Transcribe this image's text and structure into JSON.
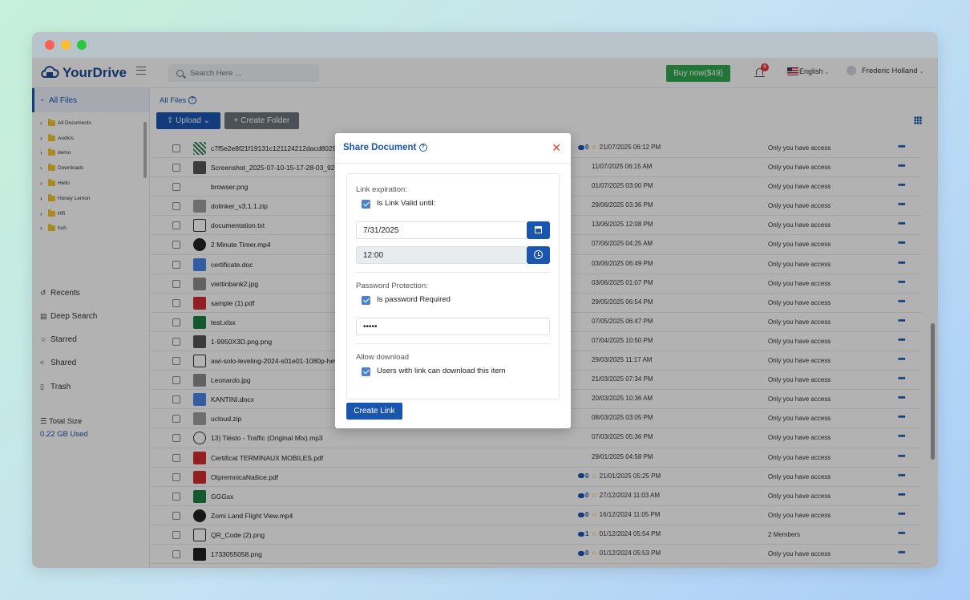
{
  "brand": {
    "name": "YourDrive"
  },
  "header": {
    "search_placeholder": "Search Here ...",
    "buy_label": "Buy now($49)",
    "notification_count": "0",
    "language": "English",
    "user_name": "Frederic Holland"
  },
  "sidebar": {
    "all_files": "All Files",
    "folders": [
      "All Documents",
      "Audios",
      "demo",
      "Downloads",
      "Hello",
      "Honey Lemon",
      "HR",
      "huh"
    ],
    "nav": [
      "Recents",
      "Deep Search",
      "Starred",
      "Shared",
      "Trash"
    ],
    "total_label": "Total Size",
    "used": "0.22 GB Used"
  },
  "main": {
    "breadcrumb": "All Files",
    "upload_label": "Upload",
    "create_folder_label": "Create Folder",
    "files": [
      {
        "name": "c7f5e2e8f21f19131c121124212dacd802923226.png",
        "comments": "0",
        "date": "21/07/2025 06:12 PM",
        "access": "Only you have access",
        "type": "qr"
      },
      {
        "name": "Screenshot_2025-07-10-15-17-28-03_92b64b2...",
        "comments": "",
        "date": "11/07/2025 06:15 AM",
        "access": "Only you have access",
        "type": "photo"
      },
      {
        "name": "browser.png",
        "comments": "",
        "date": "01/07/2025 03:00 PM",
        "access": "Only you have access",
        "type": "blank"
      },
      {
        "name": "dolinker_v3.1.1.zip",
        "comments": "",
        "date": "29/06/2025 03:36 PM",
        "access": "Only you have access",
        "type": "zip"
      },
      {
        "name": "documentation.txt",
        "comments": "",
        "date": "13/06/2025 12:08 PM",
        "access": "Only you have access",
        "type": "txt"
      },
      {
        "name": "2 Minute Timer.mp4",
        "comments": "",
        "date": "07/06/2025 04:25 AM",
        "access": "Only you have access",
        "type": "video"
      },
      {
        "name": "certificate.doc",
        "comments": "",
        "date": "03/06/2025 06:49 PM",
        "access": "Only you have access",
        "type": "doc"
      },
      {
        "name": "viettinbank2.jpg",
        "comments": "",
        "date": "03/06/2025 01:07 PM",
        "access": "Only you have access",
        "type": "photo2"
      },
      {
        "name": "sample (1).pdf",
        "comments": "",
        "date": "29/05/2025 06:54 PM",
        "access": "Only you have access",
        "type": "pdf"
      },
      {
        "name": "test.xlsx",
        "comments": "",
        "date": "07/05/2025 06:47 PM",
        "access": "Only you have access",
        "type": "xls"
      },
      {
        "name": "1-9950X3D.png.png",
        "comments": "",
        "date": "07/04/2025 10:50 PM",
        "access": "Only you have access",
        "type": "photo"
      },
      {
        "name": "awi-solo-leveling-2024-s01e01-1080p-hevc-10bi...",
        "comments": "",
        "date": "29/03/2025 11:17 AM",
        "access": "Only you have access",
        "type": "file"
      },
      {
        "name": "Leonardo.jpg",
        "comments": "",
        "date": "21/03/2025 07:34 PM",
        "access": "Only you have access",
        "type": "photo2"
      },
      {
        "name": "KANTINI.docx",
        "comments": "",
        "date": "20/03/2025 10:36 AM",
        "access": "Only you have access",
        "type": "doc"
      },
      {
        "name": "ucloud.zip",
        "comments": "",
        "date": "08/03/2025 03:05 PM",
        "access": "Only you have access",
        "type": "zip"
      },
      {
        "name": "13) Tiësto - Traffic (Original Mix).mp3",
        "comments": "",
        "date": "07/03/2025 05:36 PM",
        "access": "Only you have access",
        "type": "audio"
      },
      {
        "name": "Certificat TERMINAUX MOBILES.pdf",
        "comments": "",
        "date": "29/01/2025 04:58 PM",
        "access": "Only you have access",
        "type": "pdf"
      },
      {
        "name": "OtpremnicaNašice.pdf",
        "comments": "0",
        "date": "21/01/2025 05:25 PM",
        "access": "Only you have access",
        "type": "pdf"
      },
      {
        "name": "GGGsx",
        "comments": "0",
        "date": "27/12/2024 11:03 AM",
        "access": "Only you have access",
        "type": "xls"
      },
      {
        "name": "Zomi Land Flight View.mp4",
        "comments": "0",
        "date": "16/12/2024 11:05 PM",
        "access": "Only you have access",
        "type": "video"
      },
      {
        "name": "QR_Code (2).png",
        "comments": "1",
        "date": "01/12/2024 05:54 PM",
        "access": "2 Members",
        "type": "image"
      },
      {
        "name": "1733055058.png",
        "comments": "0",
        "date": "01/12/2024 05:53 PM",
        "access": "Only you have access",
        "type": "dark"
      }
    ]
  },
  "modal": {
    "title": "Share Document",
    "expiration_label": "Link expiration:",
    "valid_until_label": "Is Link Valid until:",
    "date_value": "7/31/2025",
    "time_value": "12:00",
    "password_section_label": "Password Protection:",
    "password_required_label": "Is password Required",
    "password_value": "•••••",
    "download_section_label": "Allow download",
    "download_label": "Users with link can download this item",
    "create_label": "Create Link"
  }
}
